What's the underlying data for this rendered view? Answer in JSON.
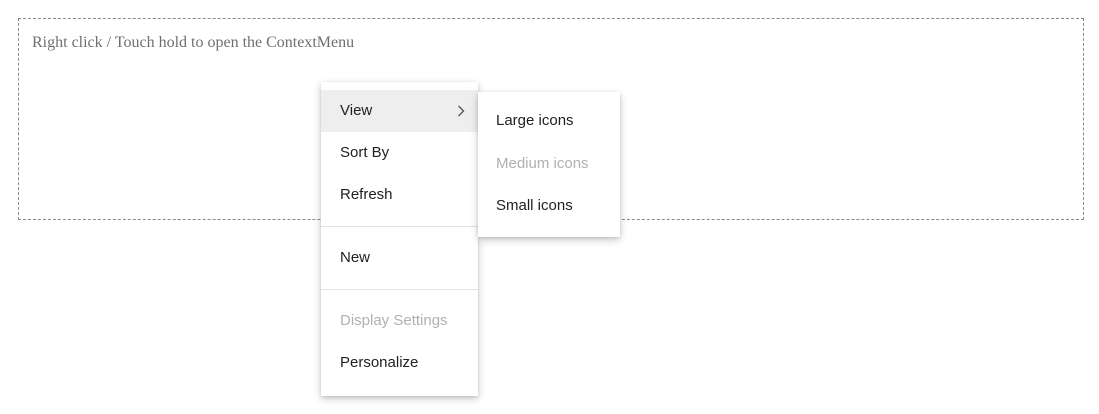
{
  "target": {
    "hint": "Right click / Touch hold to open the ContextMenu"
  },
  "context_menu": {
    "items": [
      {
        "label": "View",
        "has_submenu": true,
        "active": true
      },
      {
        "label": "Sort By"
      },
      {
        "label": "Refresh"
      },
      {
        "label": "New"
      },
      {
        "label": "Display Settings",
        "disabled": true
      },
      {
        "label": "Personalize"
      }
    ],
    "submenu": {
      "items": [
        {
          "label": "Large icons"
        },
        {
          "label": "Medium icons",
          "disabled": true
        },
        {
          "label": "Small icons"
        }
      ]
    }
  },
  "icons": {
    "submenu_caret": "chevron-right-icon"
  },
  "colors": {
    "active_item_bg": "#eeeeee",
    "disabled_text": "#b0b0b0",
    "text": "#212121",
    "border_dashed": "#8a8a8a"
  }
}
